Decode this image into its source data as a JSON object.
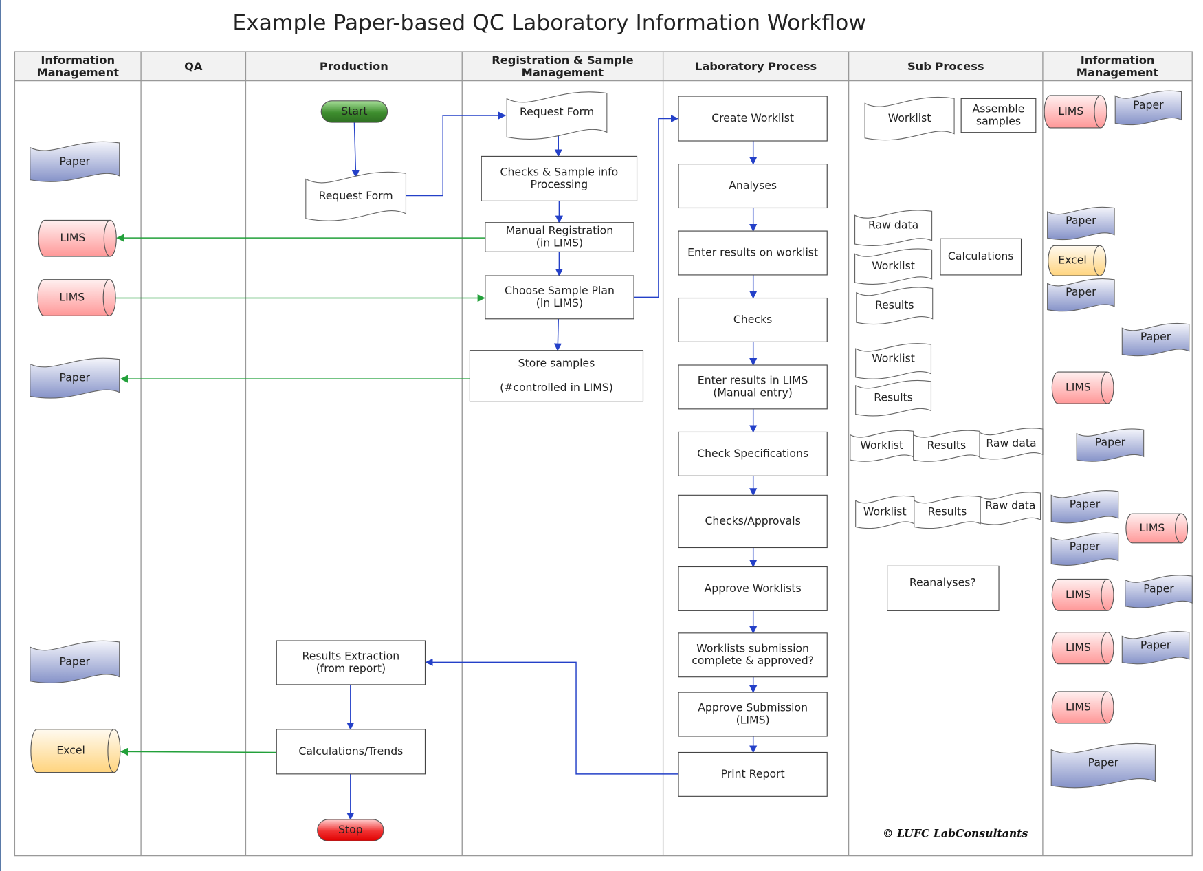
{
  "title": "Example Paper-based QC Laboratory Information Workflow",
  "copyright": "© LUFC LabConsultants",
  "colors": {
    "flow": "#2440c8",
    "data_link": "#22a03a",
    "start": "#3e8e2e",
    "stop": "#e81010",
    "paper": "#8f9ccd",
    "lims": "#ff9a9a",
    "excel": "#ffd98a"
  },
  "lanes": [
    "Information Management",
    "QA",
    "Production",
    "Registration & Sample Management",
    "Laboratory Process",
    "Sub Process",
    "Information Management"
  ],
  "lane_headers": [
    [
      "Information",
      "Management"
    ],
    [
      "QA"
    ],
    [
      "Production"
    ],
    [
      "Registration & Sample",
      "Management"
    ],
    [
      "Laboratory Process"
    ],
    [
      "Sub Process"
    ],
    [
      "Information",
      "Management"
    ]
  ],
  "terminals": {
    "start": "Start",
    "stop": "Stop"
  },
  "production": {
    "request_form": "Request Form",
    "results_extraction": [
      "Results Extraction",
      "(from report)"
    ],
    "calculations_trends": "Calculations/Trends"
  },
  "registration": {
    "request_form": "Request Form",
    "checks_processing": [
      "Checks & Sample info",
      "Processing"
    ],
    "manual_registration": [
      "Manual Registration",
      "(in LIMS)"
    ],
    "choose_sample_plan": [
      "Choose Sample Plan",
      "(in LIMS)"
    ],
    "store_samples": [
      "Store samples",
      "(#controlled in LIMS)"
    ]
  },
  "lab_process": [
    [
      "Create Worklist"
    ],
    [
      "Analyses"
    ],
    [
      "Enter results on worklist"
    ],
    [
      "Checks"
    ],
    [
      "Enter results in LIMS",
      "(Manual entry)"
    ],
    [
      "Check Specifications"
    ],
    [
      "Checks/Approvals"
    ],
    [
      "Approve Worklists"
    ],
    [
      "Worklists submission",
      "complete & approved?"
    ],
    [
      "Approve Submission",
      "(LIMS)"
    ],
    [
      "Print Report"
    ]
  ],
  "sub_process": {
    "worklist": "Worklist",
    "assemble_samples": [
      "Assemble",
      "samples"
    ],
    "raw_data": "Raw data",
    "worklist2": "Worklist",
    "results": "Results",
    "calculations": "Calculations",
    "worklist3": "Worklist",
    "results2": "Results",
    "row1": [
      "Worklist",
      "Results",
      "Raw data"
    ],
    "row2": [
      "Worklist",
      "Results",
      "Raw data"
    ],
    "reanalyses": "Reanalyses?"
  },
  "info_left": [
    "Paper",
    "LIMS",
    "LIMS",
    "Paper",
    "Paper",
    "Excel"
  ],
  "info_right": [
    "LIMS",
    "Paper",
    "Paper",
    "Excel",
    "Paper",
    "Paper",
    "LIMS",
    "Paper",
    "Paper",
    "LIMS",
    "Paper",
    "LIMS",
    "Paper",
    "LIMS",
    "Paper",
    "LIMS",
    "Paper"
  ]
}
